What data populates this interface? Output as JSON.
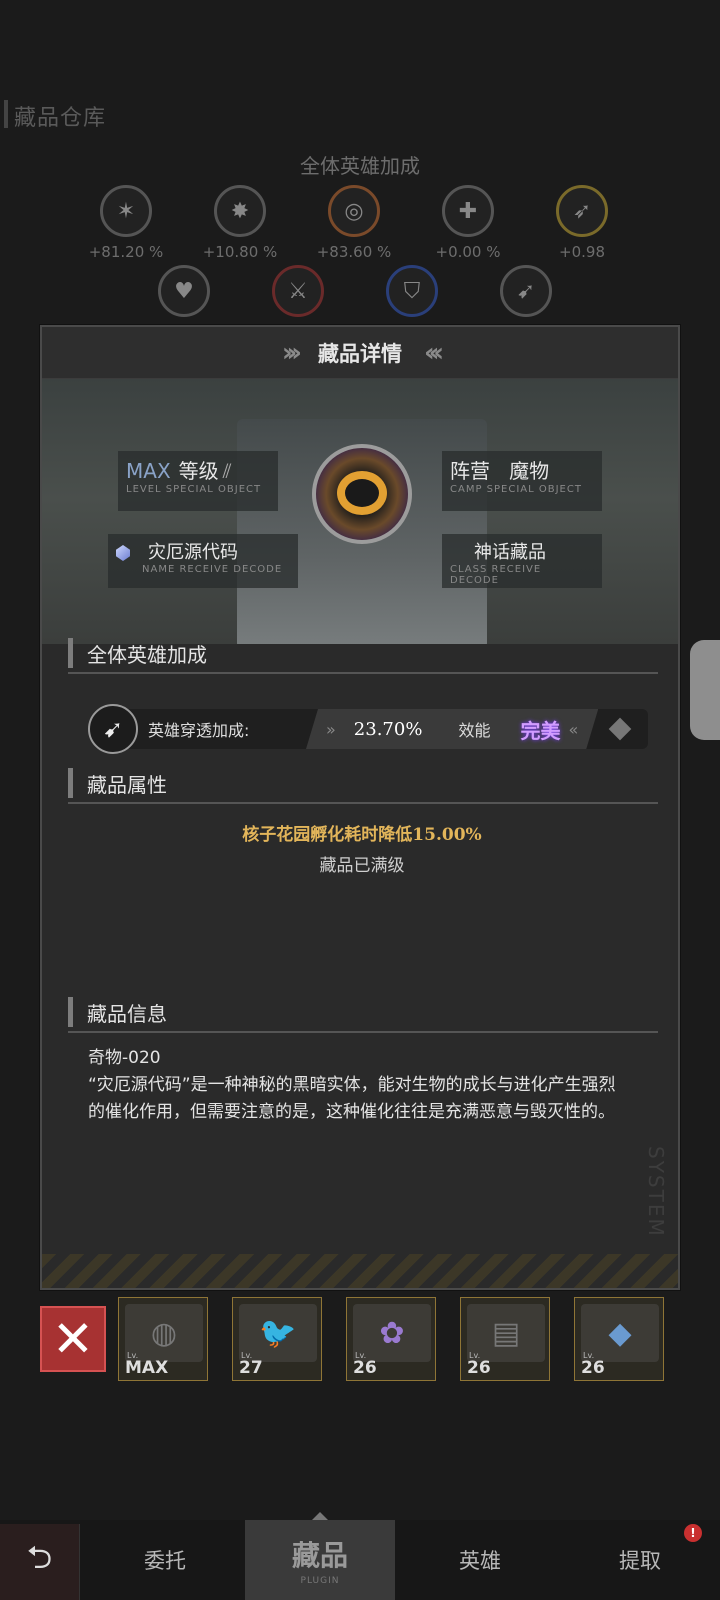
{
  "background": {
    "title": "藏品仓库",
    "subtitle": "全体英雄加成",
    "bonuses": [
      {
        "icon": "claw-icon",
        "value": "+81.20 %"
      },
      {
        "icon": "burst-icon",
        "value": "+10.80 %"
      },
      {
        "icon": "target-icon",
        "value": "+83.60 %"
      },
      {
        "icon": "heal-icon",
        "value": "+0.00 %"
      },
      {
        "icon": "runner-icon",
        "value": "+0.98"
      }
    ]
  },
  "modal": {
    "title": "藏品详情",
    "level_tag": "MAX",
    "level_label": "等级",
    "level_sub": "LEVEL  SPECIAL OBJECT",
    "faction_label": "阵营",
    "faction_value": "魔物",
    "faction_sub": "CAMP  SPECIAL OBJECT",
    "name_value": "灾厄源代码",
    "name_sub": "NAME  RECEIVE DECODE",
    "class_value": "神话藏品",
    "class_sub": "CLASS  RECEIVE DECODE",
    "section_bonus": "全体英雄加成",
    "bonus_label": "英雄穿透加成:",
    "bonus_value": "23.70%",
    "efficacy_label": "效能",
    "efficacy_rank": "完美",
    "section_attr": "藏品属性",
    "attr_effect": "核子花园孵化耗时降低15.00%",
    "attr_status": "藏品已满级",
    "section_info": "藏品信息",
    "info_id": "奇物-020",
    "info_desc": "“灾厄源代码”是一种神秘的黑暗实体，能对生物的成长与进化产生强烈的催化作用，但需要注意的是，这种催化往往是充满恶意与毁灭性的。",
    "side_text": "SYSTEM"
  },
  "items": [
    {
      "level_prefix": "Lv.",
      "level": "MAX",
      "icon": "globe-icon"
    },
    {
      "level_prefix": "Lv.",
      "level": "27",
      "icon": "crow-icon"
    },
    {
      "level_prefix": "Lv.",
      "level": "26",
      "icon": "flower-icon"
    },
    {
      "level_prefix": "Lv.",
      "level": "26",
      "icon": "monitor-icon"
    },
    {
      "level_prefix": "Lv.",
      "level": "26",
      "icon": "crystal-icon"
    }
  ],
  "nav": {
    "tabs": [
      {
        "label": "委托"
      },
      {
        "label": "藏品",
        "sub": "PLUGIN",
        "active": true
      },
      {
        "label": "英雄"
      },
      {
        "label": "提取",
        "badge": "!"
      }
    ]
  },
  "colors": {
    "accent_gold": "#e2b55a",
    "rank_purple": "#d29cff",
    "delete_red": "#a73232"
  }
}
